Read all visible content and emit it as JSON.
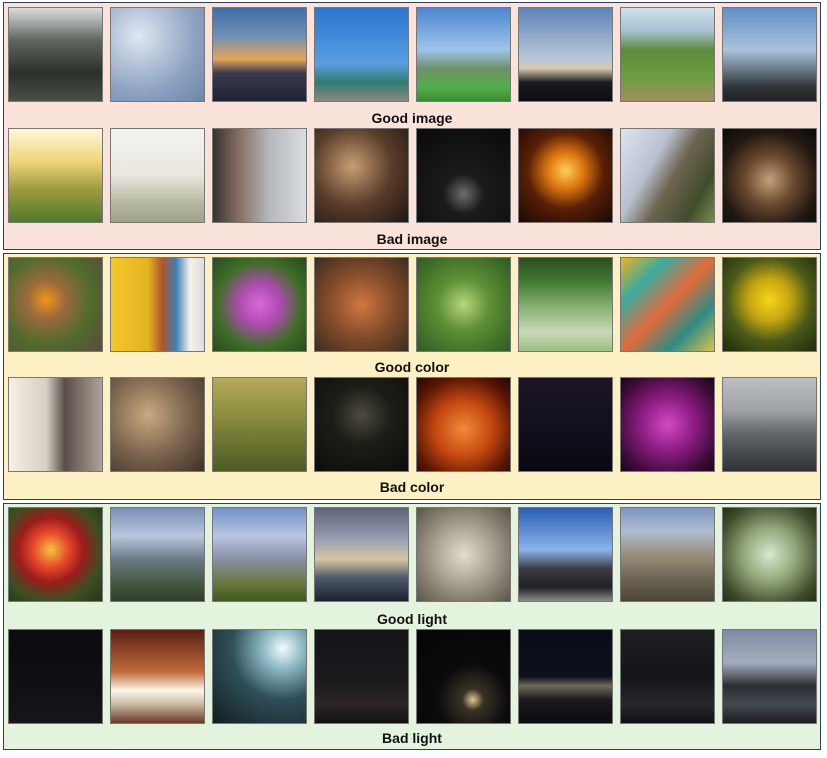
{
  "panels": [
    {
      "rows": [
        {
          "label": "Good image",
          "thumbs": [
            {
              "name": "forest-sunbeams",
              "bg": "linear-gradient(180deg,#d9dedc 0%,#5e665f 35%,#2b302a 70%,#4a4f45 100%)"
            },
            {
              "name": "cloud-texture",
              "bg": "radial-gradient(circle at 30% 30%,#dfe7f2,#8fa3c2 60%,#6e85ab)"
            },
            {
              "name": "sunset-canal",
              "bg": "linear-gradient(180deg,#3f6ea7 0%,#6f8fb5 30%,#e6a458 55%,#3b3a4f 70%,#1d2234 100%)"
            },
            {
              "name": "ornate-gate",
              "bg": "linear-gradient(180deg,#2a76cf 0%,#5a9ee0 60%,#2e7a6e 80%,#8a8a82 100%)"
            },
            {
              "name": "bay-mountain",
              "bg": "linear-gradient(180deg,#4d86d1 0%,#9fc4ea 45%,#6e8f6a 65%,#52b04a 85%,#3d8a33 100%)"
            },
            {
              "name": "city-skyline-dusk",
              "bg": "linear-gradient(180deg,#5e84b8 0%,#b9c8d8 55%,#d8c9b0 65%,#1b1c20 80%,#0d0d0f 100%)"
            },
            {
              "name": "garden-path",
              "bg": "linear-gradient(180deg,#cfe2ee 0%,#a7bfd0 25%,#5d8a3c 45%,#6e9d40 75%,#a48e63 100%)"
            },
            {
              "name": "lighthouse-coast",
              "bg": "linear-gradient(180deg,#5f8fc7 0%,#aac2da 45%,#6d7d8d 65%,#2e3438 85%,#222 100%)"
            }
          ]
        },
        {
          "label": "Bad image",
          "thumbs": [
            {
              "name": "overexposed-tree",
              "bg": "linear-gradient(180deg,#fff8d8 0%,#f0d47a 35%,#9e9a3e 65%,#4f7a2c 100%)"
            },
            {
              "name": "blurry-field",
              "bg": "linear-gradient(180deg,#f4f4ef 0%,#e8e6df 50%,#b5b89e 80%,#9ea184 100%)"
            },
            {
              "name": "motion-blur-person",
              "bg": "linear-gradient(90deg,#3c3130 0%,#8a7268 30%,#b4b7bb 60%,#dadde0 100%)"
            },
            {
              "name": "dim-tent-interior",
              "bg": "radial-gradient(circle at 40% 40%,#c99d74,#5a3d2a 50%,#1f1611)"
            },
            {
              "name": "dark-blur-lights",
              "bg": "radial-gradient(circle at 50% 70%,#6d6d6d 0%,#1b1b1b 25%,#0a0a0a 100%)"
            },
            {
              "name": "orange-figure-dark",
              "bg": "radial-gradient(circle at 50% 45%,#ffcf5a 0%,#e07a12 25%,#5a1f06 55%,#1a0704 100%)"
            },
            {
              "name": "blurry-tree-trunk",
              "bg": "linear-gradient(120deg,#dfe4ee 0%,#b8bfcf 35%,#6d6450 55%,#3f4c2b 80%,#7c8d4a 100%)"
            },
            {
              "name": "concert-stage",
              "bg": "radial-gradient(circle at 50% 55%,#c4a07a 0%,#6b4a30 35%,#221812 70%,#0d0906 100%)"
            }
          ]
        }
      ]
    },
    {
      "rows": [
        {
          "label": "Good color",
          "thumbs": [
            {
              "name": "butterfly-flowers",
              "bg": "radial-gradient(circle at 40% 45%,#f1941a 0%,#9b6a3d 25%,#4f6b2d 60%,#5b4a3a 100%)"
            },
            {
              "name": "yellow-wall-corner",
              "bg": "linear-gradient(90deg,#f2c82a 0%,#e4b324 40%,#b0552e 55%,#3c7fb8 70%,#f6f2ea 85%,#ddd 100%)"
            },
            {
              "name": "pink-azalea",
              "bg": "radial-gradient(circle at 50% 50%,#d66bd4 0%,#b04bb3 30%,#3f6d27 65%,#2a4a1c 100%)"
            },
            {
              "name": "autumn-leaves",
              "bg": "radial-gradient(circle at 50% 50%,#d17843 0%,#8a4f2c 45%,#3d2b1e 100%)"
            },
            {
              "name": "green-plant-closeup",
              "bg": "radial-gradient(circle at 50% 50%,#b8d67a 0%,#5d8f36 40%,#2f5a23 100%)"
            },
            {
              "name": "wildflower-meadow",
              "bg": "linear-gradient(180deg,#2b4d21 0%,#3f7a33 25%,#8eb476 55%,#c9d9b8 80%,#9ebf84 100%)"
            },
            {
              "name": "colorful-scales",
              "bg": "linear-gradient(135deg,#e8b429 0%,#3ea89c 25%,#e26b3a 50%,#2f8b86 75%,#d8c450 100%)"
            },
            {
              "name": "yellow-daisies",
              "bg": "radial-gradient(circle at 50% 45%,#f6d518 0%,#c7a612 30%,#4b5a18 60%,#1e2a0c 100%)"
            }
          ]
        },
        {
          "label": "Bad color",
          "thumbs": [
            {
              "name": "washed-office-worker",
              "bg": "linear-gradient(90deg,#f6f1e4 0%,#d6cfc2 40%,#5a4d48 60%,#aea39a 100%)"
            },
            {
              "name": "gravel-pebbles",
              "bg": "radial-gradient(circle at 40% 40%,#c9a97f 0%,#7e6650 50%,#3d3126 100%)"
            },
            {
              "name": "murky-green-room",
              "bg": "linear-gradient(180deg,#b6a95a 0%,#8c8d3f 40%,#4b5a24 100%)"
            },
            {
              "name": "night-tower-lights",
              "bg": "radial-gradient(circle at 50% 40%,#4d4b3e 0%,#1d1d18 40%,#0b0b09 100%)"
            },
            {
              "name": "orange-vase",
              "bg": "radial-gradient(circle at 50% 55%,#f08a3a 0%,#c64910 40%,#5a1604 75%,#240602 100%)"
            },
            {
              "name": "dark-purple-scene",
              "bg": "linear-gradient(180deg,#1b1526 0%,#120e1c 60%,#0a0812 100%)"
            },
            {
              "name": "magenta-guitarist",
              "bg": "radial-gradient(circle at 50% 50%,#d24ac4 0%,#8f1d85 40%,#3a0b36 80%,#1a0518 100%)"
            },
            {
              "name": "empty-gallery-hall",
              "bg": "linear-gradient(180deg,#bcc0c4 0%,#9ea2a6 35%,#60666b 60%,#2f3235 100%)"
            }
          ]
        }
      ]
    },
    {
      "rows": [
        {
          "label": "Good light",
          "thumbs": [
            {
              "name": "red-rose",
              "bg": "radial-gradient(circle at 45% 45%,#f7c23e 0%,#e6462c 25%,#9b1d1b 45%,#3d4f22 70%,#24331a 100%)"
            },
            {
              "name": "mountain-valley",
              "bg": "linear-gradient(180deg,#7a8fb6 0%,#b9c7df 30%,#6b7a86 55%,#465a42 80%,#2f3d2a 100%)"
            },
            {
              "name": "sun-flare-hills",
              "bg": "linear-gradient(180deg,#7390c8 0%,#b8c6e6 30%,#8a8fa5 55%,#6b7840 80%,#3d5a22 100%)"
            },
            {
              "name": "stormy-sunset-sea",
              "bg": "linear-gradient(180deg,#5d6478 0%,#9aa2b6 35%,#d6c7a2 55%,#4e596b 75%,#1d2330 100%)"
            },
            {
              "name": "painted-vases",
              "bg": "radial-gradient(circle at 50% 50%,#e4ddd0 0%,#a8a090 45%,#5a5448 100%)"
            },
            {
              "name": "steam-locomotive",
              "bg": "linear-gradient(180deg,#2a5fb8 0%,#8cb3e8 45%,#3d3e45 65%,#1f2024 85%,#8b8c8a 100%)"
            },
            {
              "name": "rocky-desert-hills",
              "bg": "linear-gradient(180deg,#7d95c4 0%,#aebccf 25%,#9c8e7c 50%,#6f6656 75%,#4a4535 100%)"
            },
            {
              "name": "backlit-sprigs",
              "bg": "radial-gradient(circle at 50% 50%,#d9e8d0 0%,#94a77a 40%,#3d4a2a 80%,#24301a 100%)"
            }
          ]
        },
        {
          "label": "Bad light",
          "thumbs": [
            {
              "name": "dark-city-night",
              "bg": "linear-gradient(180deg,#0b0b10 0%,#0f0f14 60%,#16151a 100%)"
            },
            {
              "name": "overexposed-headlights",
              "bg": "linear-gradient(180deg,#5a1f14 0%,#c06a3a 45%,#fff7ea 65%,#c8b8a2 80%,#6a3a28 100%)"
            },
            {
              "name": "bright-window-glare",
              "bg": "radial-gradient(circle at 75% 20%,#f4fbff 0%,#8db8c4 20%,#2f4f58 50%,#121d21 100%)"
            },
            {
              "name": "dim-harbor-night",
              "bg": "linear-gradient(180deg,#141317 0%,#1c1a1d 55%,#2a2624 80%,#111012 100%)"
            },
            {
              "name": "dark-tree-lights",
              "bg": "radial-gradient(circle at 60% 75%,#e0c890 0%,#3a3226 12%,#0b0a0c 40%,#050506 100%)"
            },
            {
              "name": "night-lights-street",
              "bg": "linear-gradient(180deg,#0a0c18 0%,#0d0f1c 50%,#6f6a5a 60%,#1a1a1f 75%,#0c0c10 100%)"
            },
            {
              "name": "dark-parking-lot",
              "bg": "linear-gradient(180deg,#1d1e22 0%,#141518 50%,#26282c 80%,#101114 100%)"
            },
            {
              "name": "dim-coastline",
              "bg": "linear-gradient(180deg,#7e8aa0 0%,#a4aec0 35%,#2c2e33 60%,#44484f 80%,#1b1c20 100%)"
            }
          ]
        }
      ]
    }
  ]
}
